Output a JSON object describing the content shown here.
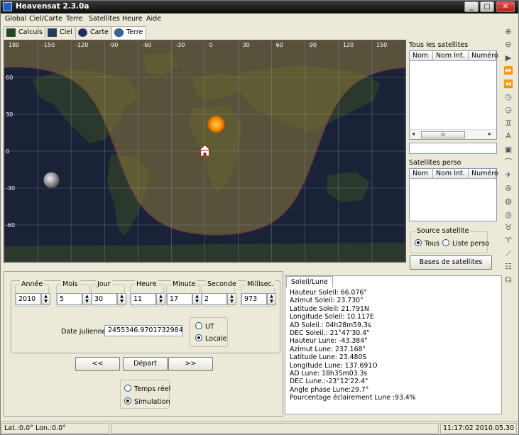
{
  "window": {
    "title": "Heavensat 2.3.0a",
    "buttons": {
      "minimize": "_",
      "maximize": "□",
      "close": "✕"
    }
  },
  "menu": [
    "Global",
    "Ciel/Carte",
    "Terre",
    "Satellites",
    "Heure",
    "Aide"
  ],
  "mode_tabs": [
    {
      "label": "Calculs",
      "icon": "chart-icon"
    },
    {
      "label": "Ciel",
      "icon": "sky-icon"
    },
    {
      "label": "Carte",
      "icon": "starmap-icon"
    },
    {
      "label": "Terre",
      "icon": "globe-icon",
      "active": true
    }
  ],
  "map": {
    "lon_ticks": [
      "180",
      "-150",
      "-120",
      "-90",
      "-60",
      "-30",
      "0",
      "30",
      "60",
      "90",
      "120",
      "150"
    ],
    "lat_ticks": [
      "60",
      "30",
      "0",
      "-30",
      "-60"
    ],
    "sun": {
      "lon": 10.117,
      "lat": 21.791
    },
    "moon": {
      "lon": 137.691,
      "lat": -23.48
    },
    "observer_icon": "home-icon",
    "colors": {
      "day": "#6a5a2a",
      "night": "#1a2238",
      "terminator": "#b03040",
      "sun": "#ff9a00"
    }
  },
  "sat_lists": {
    "all": {
      "title": "Tous les satellites",
      "columns": [
        "Nom",
        "Nom Int.",
        "Numéro"
      ],
      "scroll_label": "III"
    },
    "perso": {
      "title": "Satellites perso",
      "columns": [
        "Nom",
        "Nom Int.",
        "Numéro"
      ]
    },
    "source": {
      "title": "Source satellite",
      "options": [
        "Tous",
        "Liste perso"
      ],
      "selected": "Tous"
    },
    "bases_button": "Bases de satellites"
  },
  "date_fields": [
    {
      "label": "Année",
      "value": "2010"
    },
    {
      "label": "Mois",
      "value": "5"
    },
    {
      "label": "Jour",
      "value": "30"
    },
    {
      "label": "Heure",
      "value": "11"
    },
    {
      "label": "Minute",
      "value": "17"
    },
    {
      "label": "Seconde",
      "value": "2"
    },
    {
      "label": "Millisec.",
      "value": "973"
    }
  ],
  "julian": {
    "label": "Date julienne:",
    "value": "2455346.9701732984"
  },
  "timezone": {
    "options": [
      "UT",
      "Locale"
    ],
    "selected": "Locale"
  },
  "nav_buttons": {
    "prev": "<<",
    "start": "Départ",
    "next": ">>"
  },
  "mode": {
    "options": [
      "Temps réel",
      "Simulation"
    ],
    "selected": "Simulation"
  },
  "sun_moon": {
    "tab": "Soleil/Lune",
    "lines": [
      "Hauteur Soleil: 66.076°",
      "Azimut Soleil: 23.730°",
      "Latitude Soleil: 21.791N",
      "Longitude Soleil: 10.117E",
      "AD Soleil.: 04h28m59.3s",
      "DEC Soleil.: 21°47'30.4\"",
      "Hauteur Lune: -43.384°",
      "Azimut Lune: 237.168°",
      "Latitude Lune: 23.480S",
      "Longitude Lune: 137.691O",
      "AD Lune: 18h35m03.3s",
      "DEC Lune.:-23°12'22.4\"",
      "Angle phase Lune:29.7°",
      "Pourcentage éclairement Lune :93.4%"
    ]
  },
  "status": {
    "coords": "Lat.:0.0° Lon.:0.0°",
    "datetime": "11:17:02 2010.05.30"
  },
  "toolbar_icons": [
    "zoom-in-icon",
    "zoom-out-icon",
    "play-icon",
    "fast-forward-icon",
    "rewind-icon",
    "clock-icon",
    "clock-alarm-icon",
    "binoculars-icon",
    "text-icon",
    "lock-icon",
    "arc-icon",
    "satellite-icon",
    "satellite-2-icon",
    "globe-grid-icon",
    "globe-grid-2-icon",
    "binoculars-2-icon",
    "binoculars-3-icon",
    "telescope-icon",
    "satellite-3-icon",
    "person-icon"
  ],
  "toolbar_glyphs": [
    "⊕",
    "⊖",
    "▶",
    "⏩",
    "⏪",
    "◷",
    "◶",
    "♊",
    "A",
    "▣",
    "⌒",
    "✈",
    "✇",
    "◍",
    "◎",
    "♉",
    "♈",
    "⟋",
    "☷",
    "☊"
  ]
}
